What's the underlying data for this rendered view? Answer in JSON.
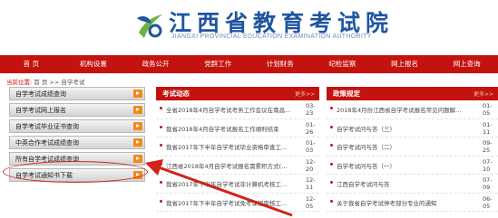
{
  "header": {
    "logo_title": "江西省教育考试院",
    "logo_subtitle": "JIANGXI PROVINCIAL EDUCATION EXAMINATION AUTHORITY"
  },
  "nav": [
    "首 页",
    "机构设置",
    "政务公开",
    "党群工作",
    "计划财务",
    "纪检监察",
    "网上报名",
    "网上查询"
  ],
  "breadcrumb": {
    "prefix": "当前位置:",
    "path": "首 页 >> 自学考试"
  },
  "sidebar": {
    "items": [
      "自学考试成绩查询",
      "自学考试网上报名",
      "自学考试毕业证书查询",
      "中英合作考试成绩查询",
      "所有自学考试成绩查询",
      "自学考试通知书下载"
    ]
  },
  "panels": {
    "left": {
      "title": "考试动态",
      "more": "更多>>",
      "rows": [
        {
          "title": "全省2018年4月自学考试考务工作会议在南昌…",
          "date_top": "03-",
          "date_bottom": "23"
        },
        {
          "title": "我省2018年4月自学考试报名工作顺利结束",
          "date_top": "01-",
          "date_bottom": "26"
        },
        {
          "title": "我省2017年下半年自学考试毕业资格审查工…",
          "date_top": "01-",
          "date_bottom": "03"
        },
        {
          "title": "江西省2018年4月自学考试报名需累积方式(…",
          "date_top": "12-",
          "date_bottom": "20"
        },
        {
          "title": "我省2017年下半年自学考试非计算机考核工…",
          "date_top": "12-",
          "date_bottom": "11"
        },
        {
          "title": "我省2017年下半年自学考试免考课程审核工…",
          "date_top": "12-",
          "date_bottom": "05"
        }
      ]
    },
    "right": {
      "title": "政策规定",
      "more": "更多>>",
      "rows": [
        {
          "title": "2018年4月份江西省自学考试报名常见问题解…",
          "date_top": "01-",
          "date_bottom": "05"
        },
        {
          "title": "自学考试问与答（三）",
          "date_top": "01-",
          "date_bottom": "11"
        },
        {
          "title": "自学考试问与答（二）",
          "date_top": "09-",
          "date_bottom": "25"
        },
        {
          "title": "自学考试问与答（一）",
          "date_top": "07-",
          "date_bottom": "10"
        },
        {
          "title": "江西自学考试问与答",
          "date_top": "07-",
          "date_bottom": "09"
        },
        {
          "title": "关于我省自学考试停考部分专业的通知",
          "date_top": "06-",
          "date_bottom": "05"
        }
      ]
    }
  },
  "colors": {
    "brand_red": "#c4130f",
    "logo_blue": "#1f55a0",
    "logo_green": "#6db33f",
    "button_orange": "#f08a1a"
  }
}
